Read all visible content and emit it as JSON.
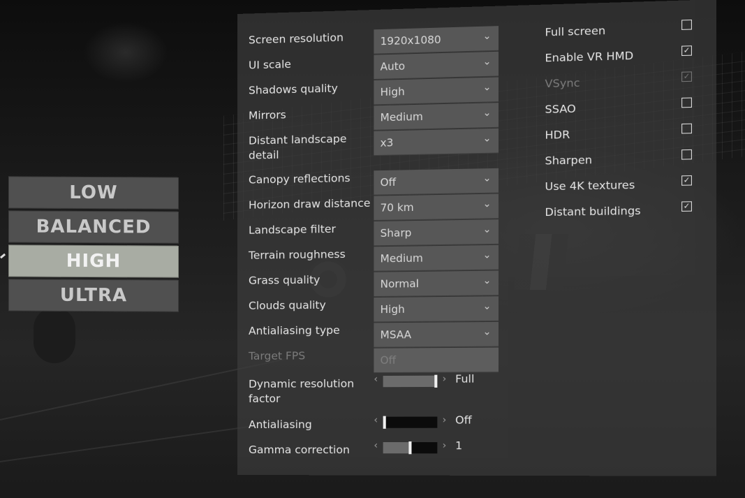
{
  "presets": {
    "items": [
      "LOW",
      "BALANCED",
      "HIGH",
      "ULTRA"
    ],
    "selected": "HIGH"
  },
  "settings": {
    "screen_resolution": {
      "label": "Screen resolution",
      "value": "1920x1080"
    },
    "ui_scale": {
      "label": "UI scale",
      "value": "Auto"
    },
    "shadows_quality": {
      "label": "Shadows quality",
      "value": "High"
    },
    "mirrors": {
      "label": "Mirrors",
      "value": "Medium"
    },
    "distant_landscape_detail": {
      "label_line1": "Distant landscape",
      "label_line2": "detail",
      "value": "x3"
    },
    "canopy_reflections": {
      "label": "Canopy reflections",
      "value": "Off"
    },
    "horizon_draw_distance": {
      "label": "Horizon draw distance",
      "value": "70 km"
    },
    "landscape_filter": {
      "label": "Landscape filter",
      "value": "Sharp"
    },
    "terrain_roughness": {
      "label": "Terrain roughness",
      "value": "Medium"
    },
    "grass_quality": {
      "label": "Grass quality",
      "value": "Normal"
    },
    "clouds_quality": {
      "label": "Clouds quality",
      "value": "High"
    },
    "antialiasing_type": {
      "label": "Antialiasing type",
      "value": "MSAA"
    },
    "target_fps": {
      "label": "Target FPS",
      "value": "Off",
      "disabled": true
    }
  },
  "sliders": {
    "dynamic_resolution_factor": {
      "label_line1": "Dynamic resolution",
      "label_line2": "factor",
      "value_text": "Full",
      "level": 1.0
    },
    "antialiasing": {
      "label": "Antialiasing",
      "value_text": "Off",
      "level": 0.0
    },
    "gamma_correction": {
      "label": "Gamma correction",
      "value_text": "1",
      "level": 0.5
    }
  },
  "checkboxes": [
    {
      "label": "Full screen",
      "checked": false,
      "disabled": false
    },
    {
      "label": "Enable VR HMD",
      "checked": true,
      "disabled": false
    },
    {
      "label": "VSync",
      "checked": true,
      "disabled": true
    },
    {
      "label": "SSAO",
      "checked": false,
      "disabled": false
    },
    {
      "label": "HDR",
      "checked": false,
      "disabled": false
    },
    {
      "label": "Sharpen",
      "checked": false,
      "disabled": false
    },
    {
      "label": "Use 4K textures",
      "checked": true,
      "disabled": false
    },
    {
      "label": "Distant buildings",
      "checked": true,
      "disabled": false
    }
  ],
  "icons": {
    "dropdown": "chevron-down-icon",
    "check": "checkmark-icon",
    "slider_left": "chevron-left-icon",
    "slider_right": "chevron-right-icon"
  },
  "colors": {
    "panel_bg": "#3a3a3a",
    "selected_preset": "#a8aca3",
    "preset_bg": "#505050"
  }
}
